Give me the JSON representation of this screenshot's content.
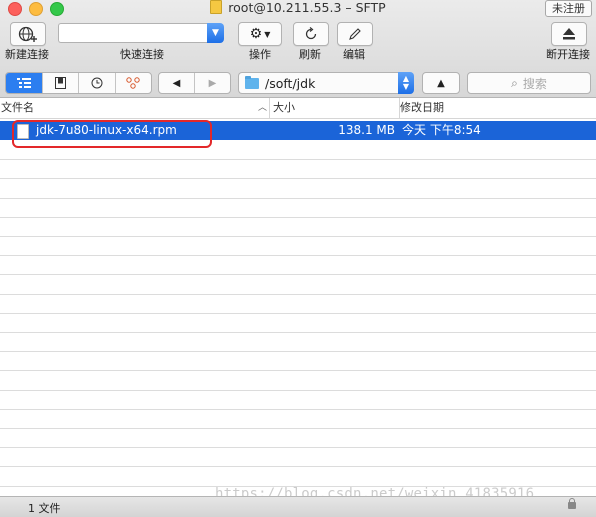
{
  "window": {
    "title": "root@10.211.55.3 – SFTP",
    "unregistered_label": "未注册"
  },
  "toolbar": {
    "new_connection_label": "新建连接",
    "quick_connect_label": "快速连接",
    "quick_connect_value": "",
    "action_label": "操作",
    "refresh_label": "刷新",
    "edit_label": "编辑",
    "disconnect_label": "断开连接"
  },
  "navbar": {
    "view_modes": [
      "list-view",
      "bookmarks",
      "history",
      "bonjour"
    ],
    "back_glyph": "◀",
    "forward_glyph": "▶",
    "path": "/soft/jdk",
    "up_glyph": "▲",
    "search_placeholder": "搜索"
  },
  "columns": {
    "name": "文件名",
    "size": "大小",
    "modified": "修改日期"
  },
  "files": [
    {
      "name": "jdk-7u80-linux-x64.rpm",
      "size": "138.1 MB",
      "modified": "今天 下午8:54",
      "selected": true
    }
  ],
  "status": {
    "count": "1 文件"
  },
  "watermark": "https://blog.csdn.net/weixin_41835916",
  "colors": {
    "selection": "#1b64d8",
    "accent": "#2c7ef0",
    "annotation": "#e3282a"
  }
}
